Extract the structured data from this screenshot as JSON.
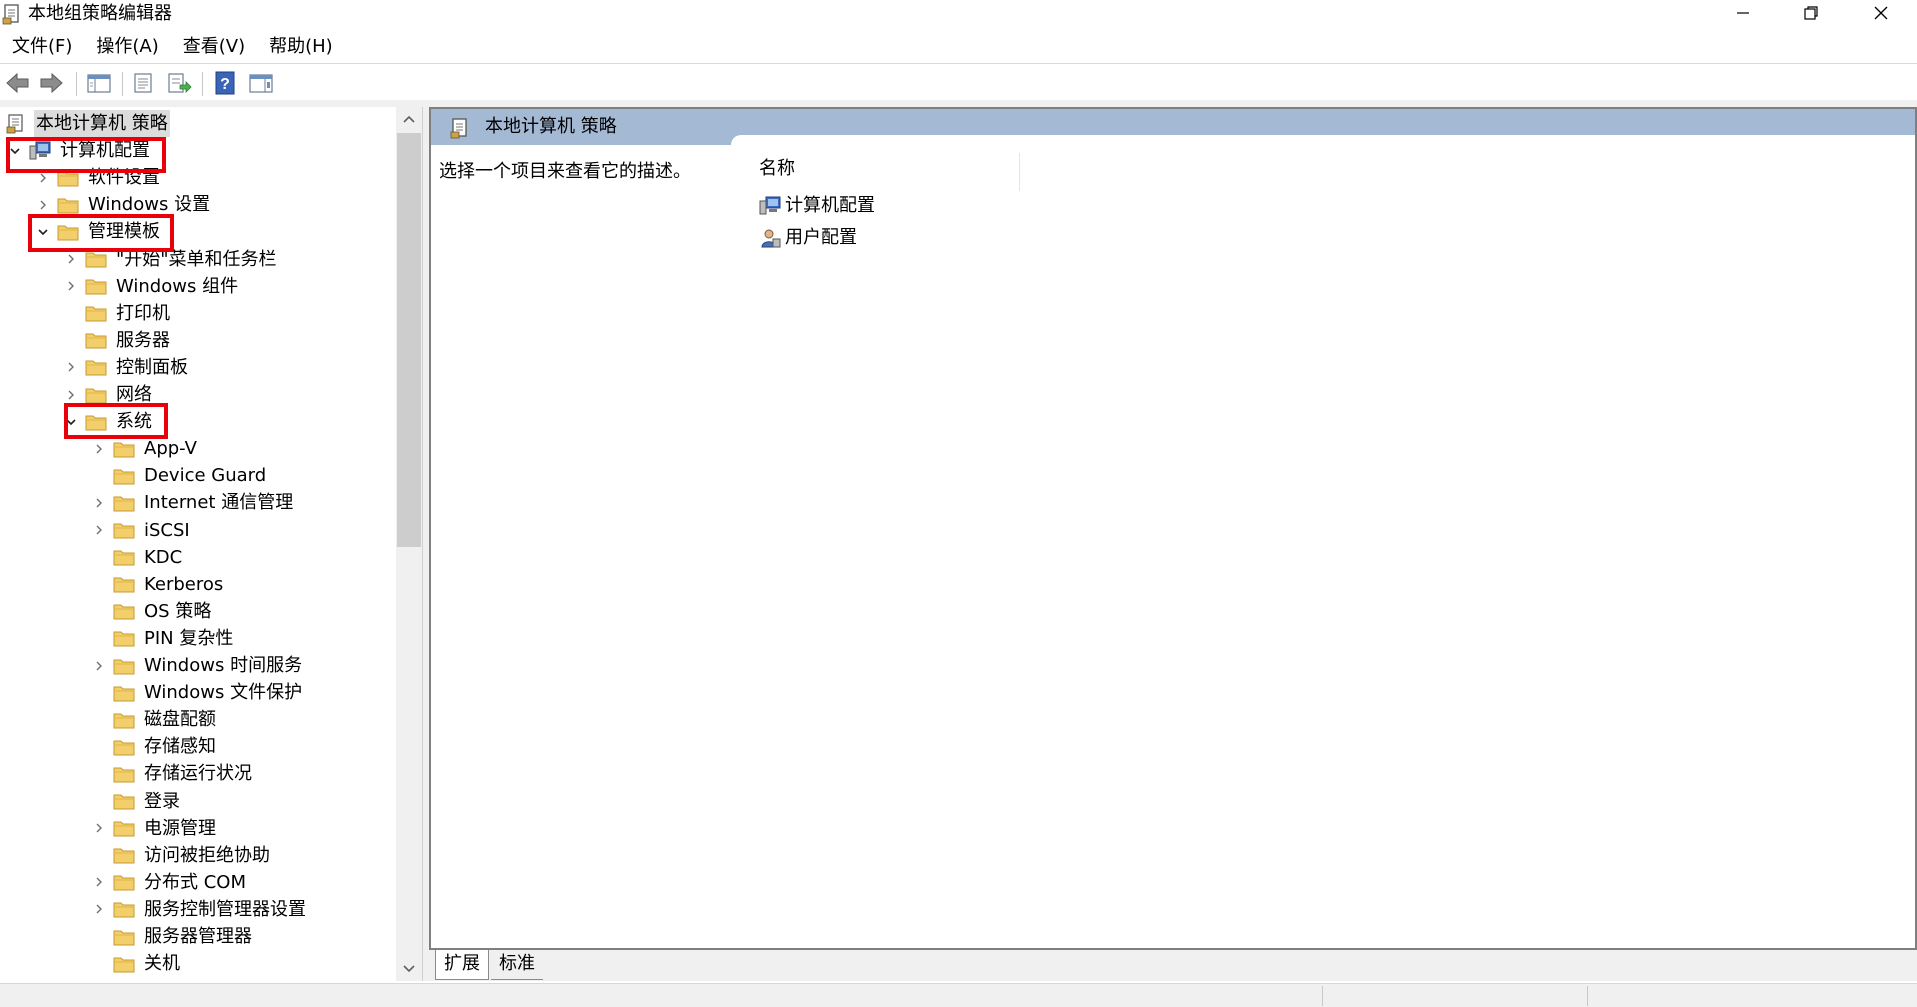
{
  "window": {
    "title": "本地组策略编辑器",
    "icons": {
      "app": "policy-document-icon",
      "minimize": "minimize-icon",
      "restore": "restore-icon",
      "close": "close-icon"
    }
  },
  "menu": [
    {
      "label": "文件(F)"
    },
    {
      "label": "操作(A)"
    },
    {
      "label": "查看(V)"
    },
    {
      "label": "帮助(H)"
    }
  ],
  "toolbar": {
    "buttons": [
      "back-arrow-icon",
      "forward-arrow-icon",
      "show-hide-tree-icon",
      "properties-icon",
      "export-list-icon",
      "help-icon",
      "show-hide-action-pane-icon"
    ]
  },
  "tree": {
    "root": {
      "label": "本地计算机 策略"
    },
    "items": [
      {
        "label": "计算机配置",
        "level": 1,
        "expanded": true,
        "icon": "computer-icon",
        "highlight": true
      },
      {
        "label": "软件设置",
        "level": 2,
        "expandable": true,
        "icon": "folder-icon"
      },
      {
        "label": "Windows 设置",
        "level": 2,
        "expandable": true,
        "icon": "folder-icon"
      },
      {
        "label": "管理模板",
        "level": 2,
        "expanded": true,
        "icon": "folder-icon",
        "highlight": true
      },
      {
        "label": "\"开始\"菜单和任务栏",
        "level": 3,
        "expandable": true,
        "icon": "folder-icon"
      },
      {
        "label": "Windows 组件",
        "level": 3,
        "expandable": true,
        "icon": "folder-icon"
      },
      {
        "label": "打印机",
        "level": 3,
        "expandable": false,
        "icon": "folder-icon"
      },
      {
        "label": "服务器",
        "level": 3,
        "expandable": false,
        "icon": "folder-icon"
      },
      {
        "label": "控制面板",
        "level": 3,
        "expandable": true,
        "icon": "folder-icon"
      },
      {
        "label": "网络",
        "level": 3,
        "expandable": true,
        "icon": "folder-icon"
      },
      {
        "label": "系统",
        "level": 3,
        "expanded": true,
        "icon": "folder-icon",
        "highlight": true
      },
      {
        "label": "App-V",
        "level": 4,
        "expandable": true,
        "icon": "folder-icon"
      },
      {
        "label": "Device Guard",
        "level": 4,
        "expandable": false,
        "icon": "folder-icon"
      },
      {
        "label": "Internet 通信管理",
        "level": 4,
        "expandable": true,
        "icon": "folder-icon"
      },
      {
        "label": "iSCSI",
        "level": 4,
        "expandable": true,
        "icon": "folder-icon"
      },
      {
        "label": "KDC",
        "level": 4,
        "expandable": false,
        "icon": "folder-icon"
      },
      {
        "label": "Kerberos",
        "level": 4,
        "expandable": false,
        "icon": "folder-icon"
      },
      {
        "label": "OS 策略",
        "level": 4,
        "expandable": false,
        "icon": "folder-icon"
      },
      {
        "label": "PIN 复杂性",
        "level": 4,
        "expandable": false,
        "icon": "folder-icon"
      },
      {
        "label": "Windows 时间服务",
        "level": 4,
        "expandable": true,
        "icon": "folder-icon"
      },
      {
        "label": "Windows 文件保护",
        "level": 4,
        "expandable": false,
        "icon": "folder-icon"
      },
      {
        "label": "磁盘配额",
        "level": 4,
        "expandable": false,
        "icon": "folder-icon"
      },
      {
        "label": "存储感知",
        "level": 4,
        "expandable": false,
        "icon": "folder-icon"
      },
      {
        "label": "存储运行状况",
        "level": 4,
        "expandable": false,
        "icon": "folder-icon"
      },
      {
        "label": "登录",
        "level": 4,
        "expandable": false,
        "icon": "folder-icon"
      },
      {
        "label": "电源管理",
        "level": 4,
        "expandable": true,
        "icon": "folder-icon"
      },
      {
        "label": "访问被拒绝协助",
        "level": 4,
        "expandable": false,
        "icon": "folder-icon"
      },
      {
        "label": "分布式 COM",
        "level": 4,
        "expandable": true,
        "icon": "folder-icon"
      },
      {
        "label": "服务控制管理器设置",
        "level": 4,
        "expandable": true,
        "icon": "folder-icon"
      },
      {
        "label": "服务器管理器",
        "level": 4,
        "expandable": false,
        "icon": "folder-icon"
      },
      {
        "label": "关机",
        "level": 4,
        "expandable": false,
        "icon": "folder-icon"
      }
    ]
  },
  "right": {
    "header_title": "本地计算机 策略",
    "description": "选择一个项目来查看它的描述。",
    "column_name": "名称",
    "items": [
      {
        "label": "计算机配置",
        "icon": "computer-icon"
      },
      {
        "label": "用户配置",
        "icon": "user-icon"
      }
    ]
  },
  "tabs": [
    {
      "label": "扩展"
    },
    {
      "label": "标准"
    }
  ],
  "colors": {
    "highlight_box": "#e8000b",
    "header_bg": "#a4b9d4",
    "folder": "#f3cf6b"
  }
}
